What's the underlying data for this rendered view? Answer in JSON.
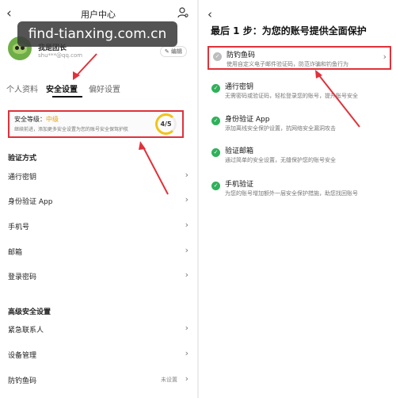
{
  "watermark": "find-tianxing.com.cn",
  "left": {
    "header_title": "用户中心",
    "back_glyph": "‹",
    "profile": {
      "name": "我是团长",
      "email": "shu***@qq.com",
      "edit_label": "编辑"
    },
    "tabs": [
      "个人资料",
      "安全设置",
      "偏好设置"
    ],
    "security": {
      "level_label": "安全等级：",
      "level_value": "中级",
      "description": "继续前进，添加更多安全设置为您的账号安全保驾护航",
      "score": "4/5"
    },
    "verify_title": "验证方式",
    "verify_items": [
      "通行密钥",
      "身份验证 App",
      "手机号",
      "邮箱",
      "登录密码"
    ],
    "advanced_title": "高级安全设置",
    "advanced_items": [
      {
        "label": "紧急联系人",
        "value": ""
      },
      {
        "label": "设备管理",
        "value": ""
      },
      {
        "label": "防钓鱼码",
        "value": "未设置"
      }
    ]
  },
  "right": {
    "back_glyph": "‹",
    "title": "最后 1 步：为您的账号提供全面保护",
    "options": [
      {
        "name": "防钓鱼码",
        "desc": "使用自定义电子邮件验证码，防范诈骗和钓鱼行为",
        "done": false
      },
      {
        "name": "通行密钥",
        "desc": "无需密码或验证码，轻松登录您的账号，提升账号安全",
        "done": true
      },
      {
        "name": "身份验证 App",
        "desc": "添加离线安全保护设置，抗网络安全漏洞攻击",
        "done": true
      },
      {
        "name": "验证邮箱",
        "desc": "通过简单的安全设置，无缝保护您的账号安全",
        "done": true
      },
      {
        "name": "手机验证",
        "desc": "为您的账号增加额外一层安全保护措施，助您找回账号",
        "done": true
      }
    ]
  },
  "colors": {
    "highlight": "#e0323a",
    "check": "#2fb15a",
    "level": "#e6a11a"
  },
  "icons": [
    "back-chevron-icon",
    "user-settings-icon",
    "chevron-right-icon",
    "check-circle-icon",
    "red-arrow-icon"
  ]
}
